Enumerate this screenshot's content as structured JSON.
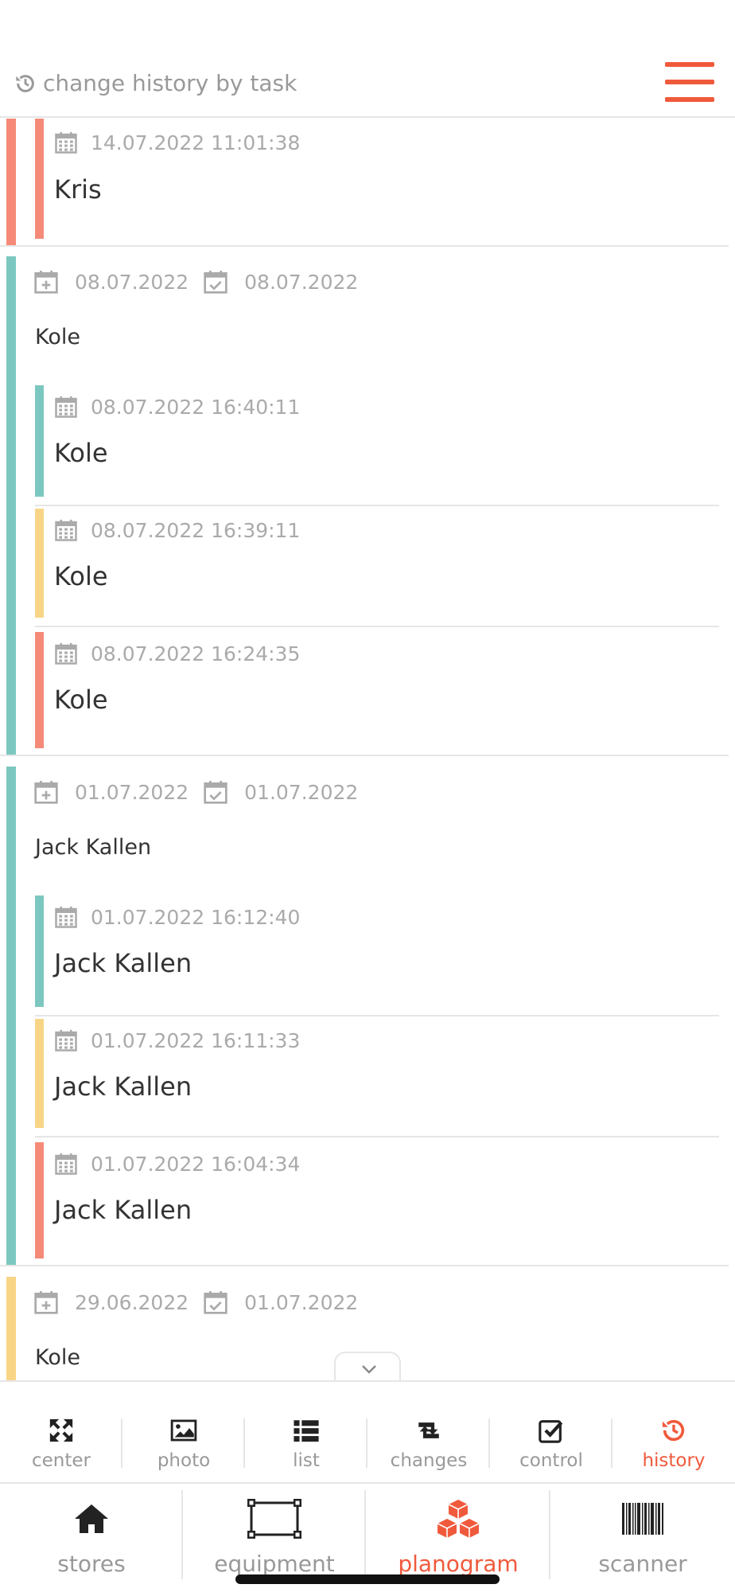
{
  "header": {
    "title": "change history by task",
    "accent": "#f05a3c"
  },
  "colors": {
    "teal": "#7cc8c0",
    "red": "#f58a78",
    "yellow": "#f8d586"
  },
  "top_entry": {
    "datetime": "14.07.2022 11:01:38",
    "name": "Kris",
    "status": "red"
  },
  "groups": [
    {
      "created": "08.07.2022",
      "completed": "08.07.2022",
      "name": "Kole",
      "status": "teal",
      "entries": [
        {
          "datetime": "08.07.2022 16:40:11",
          "name": "Kole",
          "status": "teal"
        },
        {
          "datetime": "08.07.2022 16:39:11",
          "name": "Kole",
          "status": "yellow"
        },
        {
          "datetime": "08.07.2022 16:24:35",
          "name": "Kole",
          "status": "red"
        }
      ]
    },
    {
      "created": "01.07.2022",
      "completed": "01.07.2022",
      "name": "Jack Kallen",
      "status": "teal",
      "entries": [
        {
          "datetime": "01.07.2022 16:12:40",
          "name": "Jack Kallen",
          "status": "teal"
        },
        {
          "datetime": "01.07.2022 16:11:33",
          "name": "Jack Kallen",
          "status": "yellow"
        },
        {
          "datetime": "01.07.2022 16:04:34",
          "name": "Jack Kallen",
          "status": "red"
        }
      ]
    },
    {
      "created": "29.06.2022",
      "completed": "01.07.2022",
      "name": "Kole",
      "status": "yellow",
      "entries": []
    }
  ],
  "toolbar": {
    "items": [
      {
        "label": "center",
        "icon": "expand-icon"
      },
      {
        "label": "photo",
        "icon": "image-icon"
      },
      {
        "label": "list",
        "icon": "list-icon"
      },
      {
        "label": "changes",
        "icon": "retweet-icon"
      },
      {
        "label": "control",
        "icon": "check-square-icon"
      },
      {
        "label": "history",
        "icon": "history-icon",
        "active": true
      }
    ]
  },
  "bottom_nav": {
    "items": [
      {
        "label": "stores",
        "icon": "home-icon"
      },
      {
        "label": "equipment",
        "icon": "shelf-icon"
      },
      {
        "label": "planogram",
        "icon": "cubes-icon",
        "active": true
      },
      {
        "label": "scanner",
        "icon": "barcode-icon"
      }
    ]
  }
}
